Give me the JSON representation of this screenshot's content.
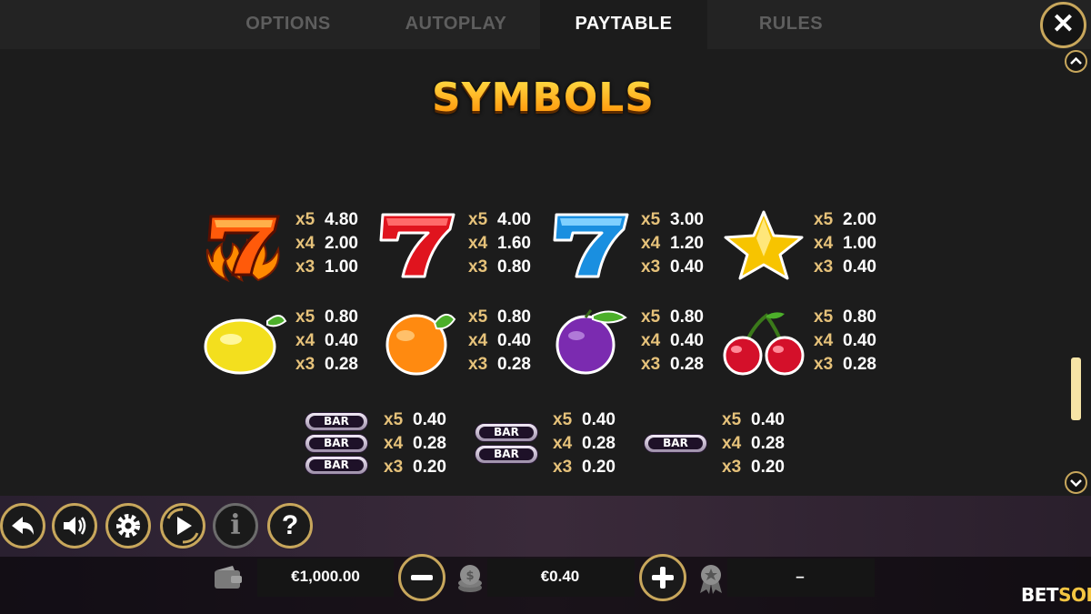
{
  "tabs": [
    {
      "label": "OPTIONS",
      "active": false
    },
    {
      "label": "AUTOPLAY",
      "active": false
    },
    {
      "label": "PAYTABLE",
      "active": true
    },
    {
      "label": "RULES",
      "active": false
    }
  ],
  "title": "SYMBOLS",
  "symbols": [
    {
      "icon": "fire-seven-icon",
      "pays": [
        {
          "count": "x5",
          "value": "4.80"
        },
        {
          "count": "x4",
          "value": "2.00"
        },
        {
          "count": "x3",
          "value": "1.00"
        }
      ]
    },
    {
      "icon": "red-seven-icon",
      "pays": [
        {
          "count": "x5",
          "value": "4.00"
        },
        {
          "count": "x4",
          "value": "1.60"
        },
        {
          "count": "x3",
          "value": "0.80"
        }
      ]
    },
    {
      "icon": "blue-seven-icon",
      "pays": [
        {
          "count": "x5",
          "value": "3.00"
        },
        {
          "count": "x4",
          "value": "1.20"
        },
        {
          "count": "x3",
          "value": "0.40"
        }
      ]
    },
    {
      "icon": "star-icon",
      "pays": [
        {
          "count": "x5",
          "value": "2.00"
        },
        {
          "count": "x4",
          "value": "1.00"
        },
        {
          "count": "x3",
          "value": "0.40"
        }
      ]
    },
    {
      "icon": "lemon-icon",
      "pays": [
        {
          "count": "x5",
          "value": "0.80"
        },
        {
          "count": "x4",
          "value": "0.40"
        },
        {
          "count": "x3",
          "value": "0.28"
        }
      ]
    },
    {
      "icon": "orange-icon",
      "pays": [
        {
          "count": "x5",
          "value": "0.80"
        },
        {
          "count": "x4",
          "value": "0.40"
        },
        {
          "count": "x3",
          "value": "0.28"
        }
      ]
    },
    {
      "icon": "plum-icon",
      "pays": [
        {
          "count": "x5",
          "value": "0.80"
        },
        {
          "count": "x4",
          "value": "0.40"
        },
        {
          "count": "x3",
          "value": "0.28"
        }
      ]
    },
    {
      "icon": "cherry-icon",
      "pays": [
        {
          "count": "x5",
          "value": "0.80"
        },
        {
          "count": "x4",
          "value": "0.40"
        },
        {
          "count": "x3",
          "value": "0.28"
        }
      ]
    },
    {
      "icon": "triple-bar-icon",
      "pays": [
        {
          "count": "x5",
          "value": "0.40"
        },
        {
          "count": "x4",
          "value": "0.28"
        },
        {
          "count": "x3",
          "value": "0.20"
        }
      ]
    },
    {
      "icon": "double-bar-icon",
      "pays": [
        {
          "count": "x5",
          "value": "0.40"
        },
        {
          "count": "x4",
          "value": "0.28"
        },
        {
          "count": "x3",
          "value": "0.20"
        }
      ]
    },
    {
      "icon": "single-bar-icon",
      "pays": [
        {
          "count": "x5",
          "value": "0.40"
        },
        {
          "count": "x4",
          "value": "0.28"
        },
        {
          "count": "x3",
          "value": "0.20"
        }
      ]
    }
  ],
  "bar_label": "BAR",
  "controls": {
    "buttons": [
      "back-icon",
      "sound-icon",
      "settings-icon",
      "autoplay-icon",
      "info-icon",
      "help-icon"
    ],
    "info_label": "i",
    "help_label": "?",
    "balance": "€1,000.00",
    "bet": "€0.40",
    "win": "–",
    "close_label": "✕"
  },
  "brand": {
    "bet": "BET",
    "soft": "SOFT"
  },
  "colors": {
    "accent_gold": "#c8a75c",
    "count_gold": "#e6c27a",
    "title_orange": "#ffb000"
  }
}
